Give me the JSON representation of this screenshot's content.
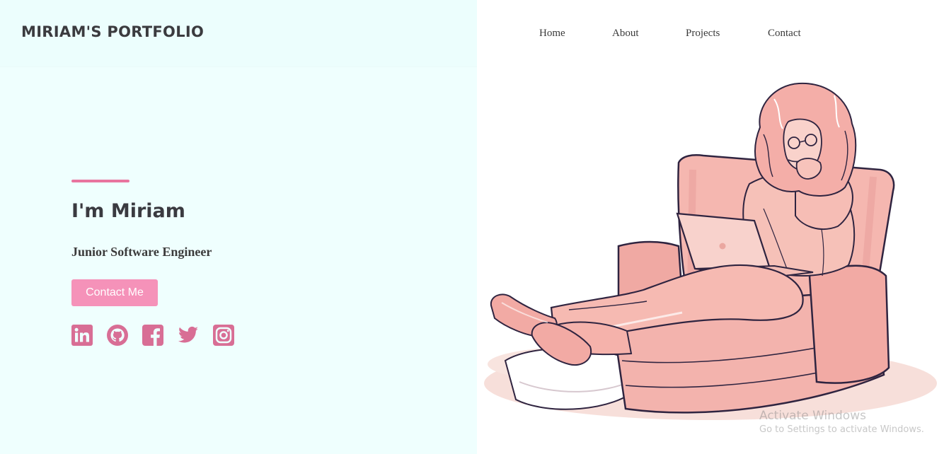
{
  "brand": {
    "name": "MIRIAM'S PORTFOLIO"
  },
  "nav": {
    "items": [
      {
        "label": "Home"
      },
      {
        "label": "About"
      },
      {
        "label": "Projects"
      },
      {
        "label": "Contact"
      }
    ]
  },
  "hero": {
    "title": "I'm Miriam",
    "subtitle": "Junior Software Engineer",
    "cta_label": "Contact Me"
  },
  "socials": [
    {
      "icon": "linkedin-icon"
    },
    {
      "icon": "github-icon"
    },
    {
      "icon": "facebook-icon"
    },
    {
      "icon": "twitter-icon"
    },
    {
      "icon": "instagram-icon"
    }
  ],
  "illustration": {
    "subject": "woman-on-armchair-with-laptop"
  },
  "watermark": {
    "title": "Activate Windows",
    "subtitle": "Go to Settings to activate Windows."
  },
  "colors": {
    "left_background": "#effffe",
    "right_background": "#ffffff",
    "accent": "#e8749f",
    "button": "#f592b9",
    "icon": "#d86e95",
    "text": "#3a3a40"
  }
}
